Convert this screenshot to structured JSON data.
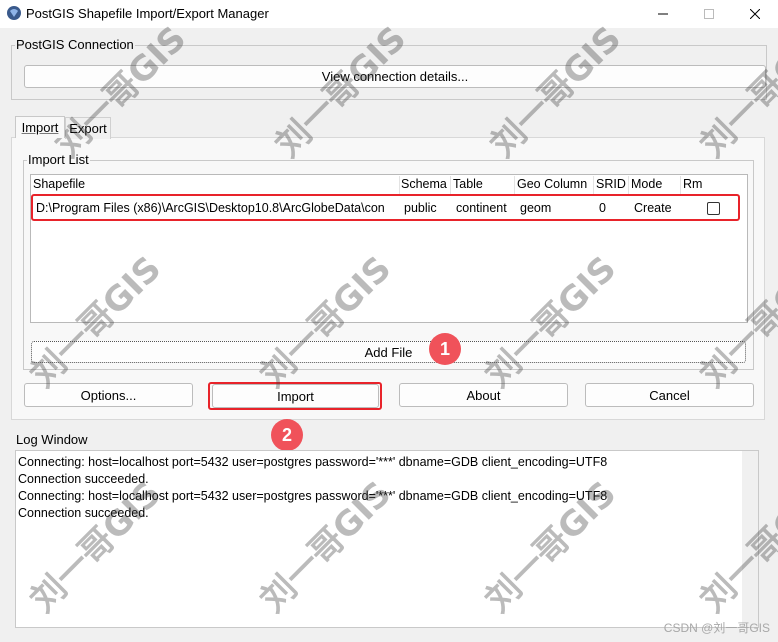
{
  "window": {
    "title": "PostGIS Shapefile Import/Export Manager"
  },
  "connection": {
    "group_label": "PostGIS Connection",
    "button_label": "View connection details..."
  },
  "tabs": [
    {
      "label": "Import"
    },
    {
      "label": "Export"
    }
  ],
  "import_list": {
    "group_label": "Import List",
    "columns": [
      "Shapefile",
      "Schema",
      "Table",
      "Geo Column",
      "SRID",
      "Mode",
      "Rm"
    ],
    "rows": [
      {
        "shapefile": "D:\\Program Files (x86)\\ArcGIS\\Desktop10.8\\ArcGlobeData\\con",
        "schema": "public",
        "table": "continent",
        "geo_column": "geom",
        "srid": "0",
        "mode": "Create",
        "rm": false
      }
    ],
    "add_file_label": "Add File"
  },
  "actions": {
    "options_label": "Options...",
    "import_label": "Import",
    "about_label": "About",
    "cancel_label": "Cancel"
  },
  "log": {
    "group_label": "Log Window",
    "lines": [
      "Connecting:  host=localhost port=5432 user=postgres password='***' dbname=GDB client_encoding=UTF8",
      "Connection succeeded.",
      "Connecting:  host=localhost port=5432 user=postgres password='***' dbname=GDB client_encoding=UTF8",
      "Connection succeeded."
    ]
  },
  "annotations": {
    "badge_1": "1",
    "badge_2": "2",
    "highlight_color": "#e8232a",
    "badge_color": "#f0525a"
  },
  "watermark": {
    "text": "刘一哥GIS"
  },
  "footer": {
    "credit": "CSDN @刘一哥GIS"
  }
}
